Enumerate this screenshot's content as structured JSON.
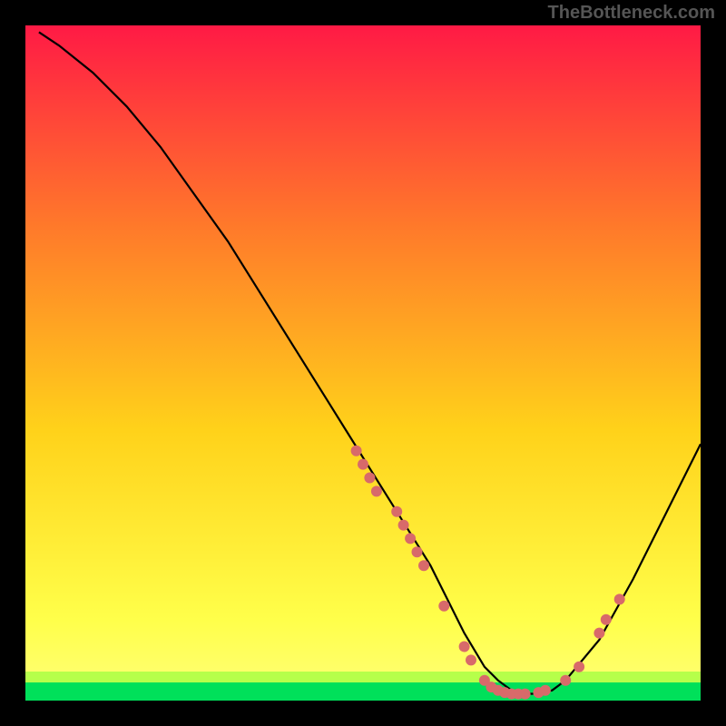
{
  "watermark": "TheBottleneck.com",
  "chart_data": {
    "type": "line",
    "title": "",
    "xlabel": "",
    "ylabel": "",
    "xlim": [
      0,
      100
    ],
    "ylim": [
      0,
      100
    ],
    "grid": false,
    "background_gradient": {
      "top": "#ff1a45",
      "mid1": "#ff7a2a",
      "mid2": "#ffd21a",
      "mid3": "#ffff4a",
      "bottom_band": "#00e05a"
    },
    "series": [
      {
        "name": "bottleneck-curve",
        "color": "#000000",
        "x": [
          2,
          5,
          10,
          15,
          20,
          25,
          30,
          35,
          40,
          45,
          50,
          55,
          60,
          62,
          65,
          68,
          70,
          72,
          75,
          78,
          80,
          85,
          90,
          95,
          100
        ],
        "y": [
          99,
          97,
          93,
          88,
          82,
          75,
          68,
          60,
          52,
          44,
          36,
          28,
          20,
          16,
          10,
          5,
          3,
          1.5,
          1,
          1.5,
          3,
          9,
          18,
          28,
          38
        ]
      }
    ],
    "scatter_points": {
      "name": "data-markers",
      "color": "#d86a6a",
      "radius": 6,
      "points": [
        {
          "x": 49,
          "y": 37
        },
        {
          "x": 50,
          "y": 35
        },
        {
          "x": 51,
          "y": 33
        },
        {
          "x": 52,
          "y": 31
        },
        {
          "x": 55,
          "y": 28
        },
        {
          "x": 56,
          "y": 26
        },
        {
          "x": 57,
          "y": 24
        },
        {
          "x": 58,
          "y": 22
        },
        {
          "x": 59,
          "y": 20
        },
        {
          "x": 62,
          "y": 14
        },
        {
          "x": 65,
          "y": 8
        },
        {
          "x": 66,
          "y": 6
        },
        {
          "x": 68,
          "y": 3
        },
        {
          "x": 69,
          "y": 2
        },
        {
          "x": 70,
          "y": 1.5
        },
        {
          "x": 71,
          "y": 1.2
        },
        {
          "x": 72,
          "y": 1
        },
        {
          "x": 73,
          "y": 1
        },
        {
          "x": 74,
          "y": 1
        },
        {
          "x": 76,
          "y": 1.2
        },
        {
          "x": 77,
          "y": 1.5
        },
        {
          "x": 80,
          "y": 3
        },
        {
          "x": 82,
          "y": 5
        },
        {
          "x": 85,
          "y": 10
        },
        {
          "x": 86,
          "y": 12
        },
        {
          "x": 88,
          "y": 15
        }
      ]
    }
  }
}
